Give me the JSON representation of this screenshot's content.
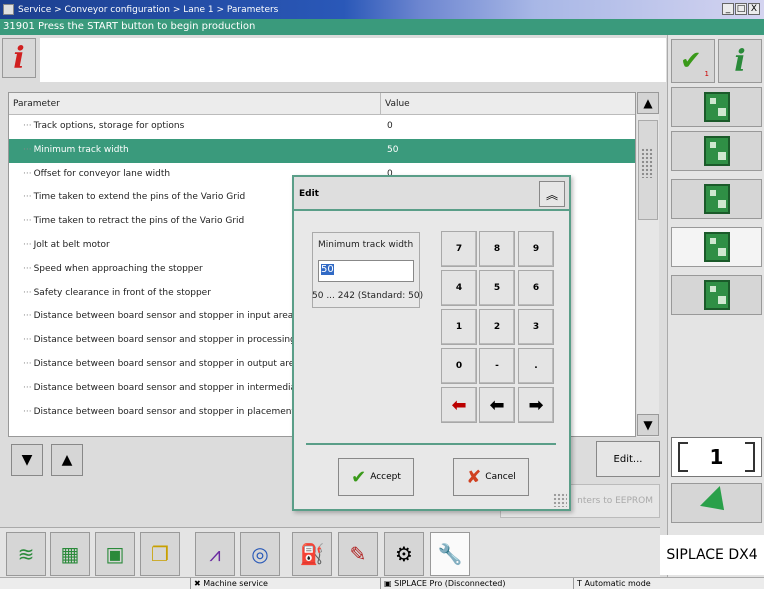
{
  "window": {
    "title": "Service > Conveyor configuration > Lane 1 > Parameters",
    "controls": [
      "_",
      "□",
      "X"
    ]
  },
  "status_message": "31901 Press the START button to begin production",
  "table": {
    "headers": {
      "parameter": "Parameter",
      "value": "Value"
    },
    "rows": [
      {
        "name": "Track options, storage for options",
        "value": "0"
      },
      {
        "name": "Minimum track width",
        "value": "50",
        "selected": true
      },
      {
        "name": "Offset for conveyor lane width",
        "value": "0"
      },
      {
        "name": "Time taken to extend the pins of the Vario Grid",
        "value": ""
      },
      {
        "name": "Time taken to retract the pins of the Vario Grid",
        "value": ""
      },
      {
        "name": "Jolt at belt motor",
        "value": ""
      },
      {
        "name": "Speed when approaching the stopper",
        "value": ""
      },
      {
        "name": "Safety clearance in front of the stopper",
        "value": ""
      },
      {
        "name": "Distance between board sensor and stopper in input area",
        "value": ""
      },
      {
        "name": "Distance between board sensor and stopper in processing a",
        "value": ""
      },
      {
        "name": "Distance between board sensor and stopper in output area",
        "value": ""
      },
      {
        "name": "Distance between board sensor and stopper in intermediate",
        "value": ""
      },
      {
        "name": "Distance between board sensor and stopper in placement sa",
        "value": ""
      }
    ]
  },
  "buttons": {
    "edit": "Edit...",
    "eeprom": "nters to EEPROM"
  },
  "dialog": {
    "title": "Edit",
    "field_label": "Minimum track width",
    "field_value": "50",
    "range": "50 ... 242 (Standard: 50)",
    "keypad": [
      "7",
      "8",
      "9",
      "4",
      "5",
      "6",
      "1",
      "2",
      "3",
      "0",
      "-",
      "."
    ],
    "accept": "Accept",
    "cancel": "Cancel"
  },
  "right_panel": {
    "check_count": "1",
    "lane_number": "1"
  },
  "brand": "SIPLACE DX4",
  "statusbar": {
    "mode": "Machine service",
    "pro": "SIPLACE Pro (Disconnected)",
    "auto": "Automatic mode"
  },
  "colors": {
    "accent": "#3a9a7c",
    "title_bar": "#1c3f8f",
    "back_arrow": "#b00000"
  }
}
